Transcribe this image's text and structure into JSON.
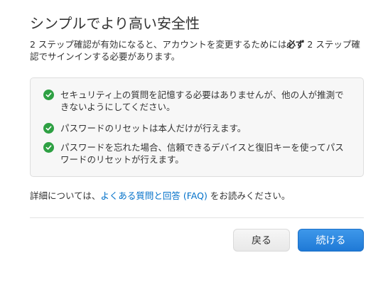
{
  "dialog": {
    "title": "シンプルでより高い安全性",
    "intro_before": "2 ステップ確認が有効になると、アカウントを変更するためには",
    "intro_bold": "必ず",
    "intro_after": " 2 ステップ確認でサインインする必要があります。"
  },
  "benefits": [
    {
      "text": "セキュリティ上の質問を記憶する必要はありませんが、他の人が推測できないようにしてください。",
      "icon": "checkmark-circle-icon"
    },
    {
      "text": "パスワードのリセットは本人だけが行えます。",
      "icon": "checkmark-circle-icon"
    },
    {
      "text": "パスワードを忘れた場合、信頼できるデバイスと復旧キーを使ってパスワードのリセットが行えます。",
      "icon": "checkmark-circle-icon"
    }
  ],
  "details": {
    "prefix": "詳細については、",
    "link": "よくある質問と回答 (FAQ)",
    "suffix": " をお読みください。"
  },
  "buttons": {
    "back": "戻る",
    "continue": "続ける"
  },
  "colors": {
    "accent": "#0070c9",
    "check": "#2ea043",
    "primary_button": "#1f79d6"
  }
}
